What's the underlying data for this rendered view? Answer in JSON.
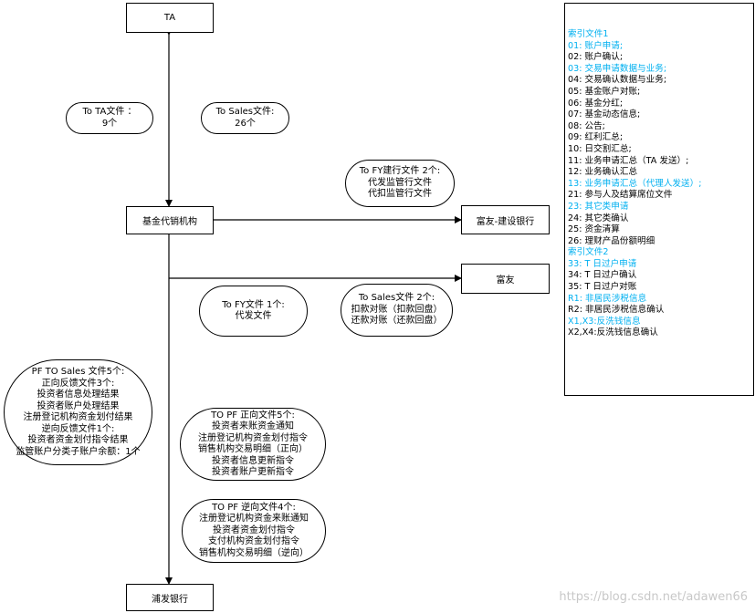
{
  "nodes": {
    "ta": "TA",
    "fund_agency": "基金代销机构",
    "fuyou_ccb": "富友-建设银行",
    "fuyou": "富友",
    "spdb": "浦发银行"
  },
  "notes": {
    "to_ta": [
      "To TA文件 ：",
      "9个"
    ],
    "to_sales_from_ta": [
      "To Sales文件:",
      "26个"
    ],
    "to_fy_ccb": [
      "To FY建行文件 2个:",
      "代发监管行文件",
      "代扣监管行文件"
    ],
    "to_fy": [
      "To FY文件 1个:",
      "代发文件"
    ],
    "to_sales_from_fy": [
      "To Sales文件 2个:",
      "扣款对账（扣款回盘）",
      "还款对账（还款回盘）"
    ],
    "pf_to_sales": [
      "PF TO Sales 文件5个:",
      "正向反馈文件3个:",
      "投资者信息处理结果",
      "投资者账户处理结果",
      "注册登记机构资金划付结果",
      "逆向反馈文件1个:",
      "投资者资金划付指令结果",
      "监管账户分类子账户余额：1个"
    ],
    "to_pf_forward": [
      "TO PF 正向文件5个:",
      "投资者来账资金通知",
      "注册登记机构资金划付指令",
      "销售机构交易明细（正向）",
      "投资者信息更新指令",
      "投资者账户更新指令"
    ],
    "to_pf_reverse": [
      "TO PF 逆向文件4个:",
      "注册登记机构资金来账通知",
      "投资者资金划付指令",
      "支付机构资金划付指令",
      "销售机构交易明细（逆向）"
    ]
  },
  "index_panel": {
    "lines": [
      {
        "text": "索引文件1",
        "color": "cyan"
      },
      {
        "text": "01: 账户申请;",
        "color": "cyan"
      },
      {
        "text": "02: 账户确认;",
        "color": "black"
      },
      {
        "text": "03: 交易申请数据与业务;",
        "color": "cyan"
      },
      {
        "text": "04: 交易确认数据与业务;",
        "color": "black"
      },
      {
        "text": "05: 基金账户对账;",
        "color": "black"
      },
      {
        "text": "06: 基金分红;",
        "color": "black"
      },
      {
        "text": "07: 基金动态信息;",
        "color": "black"
      },
      {
        "text": "08: 公告;",
        "color": "black"
      },
      {
        "text": "09: 红利汇总;",
        "color": "black"
      },
      {
        "text": "10: 日交割汇总;",
        "color": "black"
      },
      {
        "text": "11: 业务申请汇总（TA 发送）;",
        "color": "black"
      },
      {
        "text": "12: 业务确认汇总",
        "color": "black"
      },
      {
        "text": "13: 业务申请汇总（代理人发送）;",
        "color": "cyan"
      },
      {
        "text": "21: 参与人及结算席位文件",
        "color": "black"
      },
      {
        "text": "23: 其它类申请",
        "color": "cyan"
      },
      {
        "text": "24: 其它类确认",
        "color": "black"
      },
      {
        "text": "25: 资金清算",
        "color": "black"
      },
      {
        "text": "26: 理财产品份额明细",
        "color": "black"
      },
      {
        "text": "索引文件2",
        "color": "cyan"
      },
      {
        "text": "33: T 日过户申请",
        "color": "cyan"
      },
      {
        "text": "34: T 日过户确认",
        "color": "black"
      },
      {
        "text": "35: T 日过户对账",
        "color": "black"
      },
      {
        "text": "R1: 非居民涉税信息",
        "color": "cyan"
      },
      {
        "text": "R2: 非居民涉税信息确认",
        "color": "black"
      },
      {
        "text": "X1,X3:反洗钱信息",
        "color": "cyan"
      },
      {
        "text": "X2,X4:反洗钱信息确认",
        "color": "black"
      }
    ]
  },
  "watermark": "https://blog.csdn.net/adawen66",
  "colors": {
    "cyan": "#00b0f0",
    "line": "#000000"
  }
}
